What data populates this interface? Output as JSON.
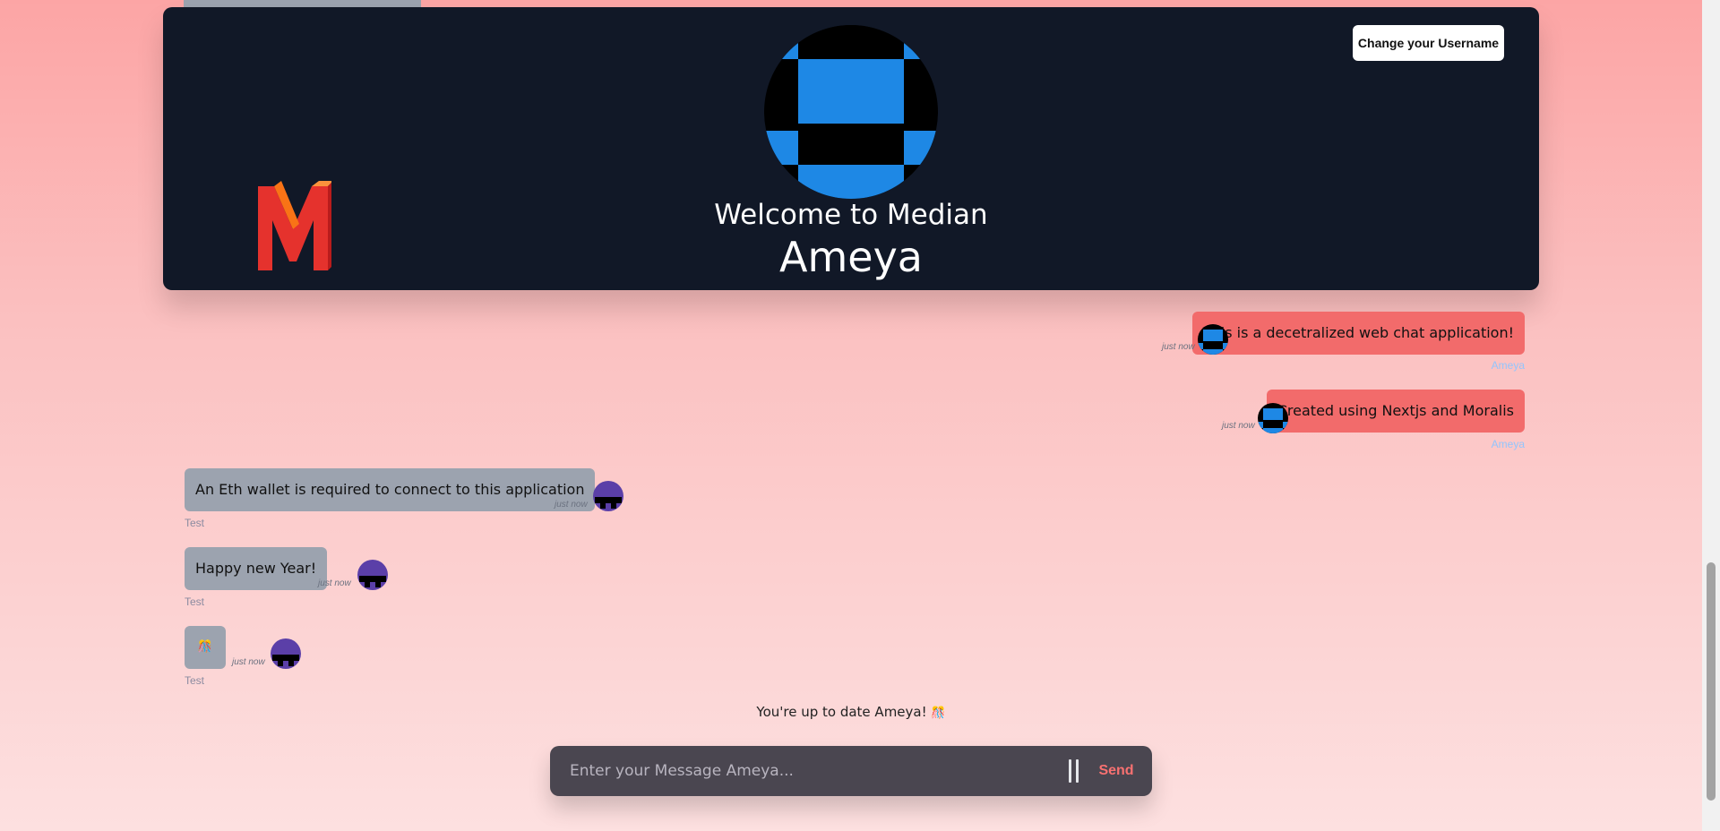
{
  "header": {
    "welcome_text": "Welcome to Median",
    "username": "Ameya",
    "change_username_label": "Change your Username"
  },
  "messages": [
    {
      "text": "This is a decetralized web chat application!",
      "time": "just now",
      "sender": "Ameya",
      "mine": true
    },
    {
      "text": "Created using Nextjs and Moralis",
      "time": "just now",
      "sender": "Ameya",
      "mine": true
    },
    {
      "text": "An Eth wallet is required to connect to this application",
      "time": "just now",
      "sender": "Test",
      "mine": false
    },
    {
      "text": "Happy new Year!",
      "time": "just now",
      "sender": "Test",
      "mine": false
    },
    {
      "text": "🎊",
      "time": "just now",
      "sender": "Test",
      "mine": false
    }
  ],
  "status": {
    "text": "You're up to date Ameya!",
    "emoji": "🎊"
  },
  "composer": {
    "placeholder": "Enter your Message Ameya...",
    "send_label": "Send"
  },
  "colors": {
    "header_bg": "#111827",
    "my_bubble": "#f26b6b",
    "their_bubble": "#9ca3af",
    "send_accent": "#f87171"
  }
}
